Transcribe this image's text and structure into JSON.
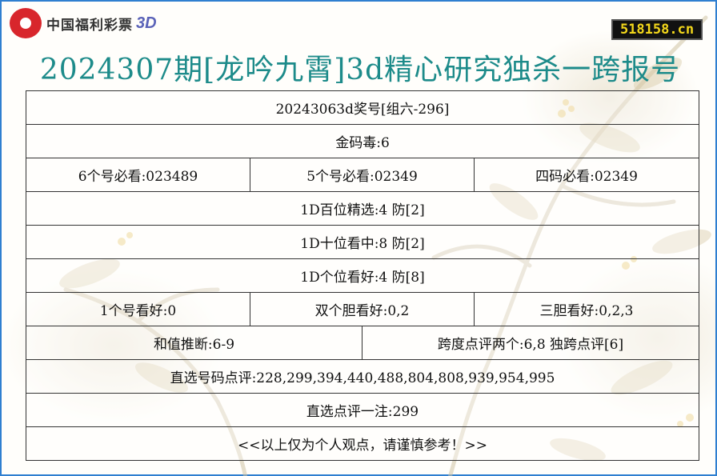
{
  "logo": {
    "text": "中国福利彩票",
    "suffix": "3D",
    "icon": "lottery-logo-icon"
  },
  "site_badge": "518158.cn",
  "title": "2024307期[龙吟九霄]3d精心研究独杀一跨报号",
  "rows": {
    "draw": "20243063d奖号[组六-296]",
    "golden": "金码毒:6",
    "six_numbers": "6个号必看:023489",
    "five_numbers": "5个号必看:02349",
    "four_numbers": "四码必看:02349",
    "hundreds": "1D百位精选:4 防[2]",
    "tens": "1D十位看中:8 防[2]",
    "units": "1D个位看好:4 防[8]",
    "one_number": "1个号看好:0",
    "double_bold": "双个胆看好:0,2",
    "triple_bold": "三胆看好:0,2,3",
    "sum_value": "和值推断:6-9",
    "span": "跨度点评两个:6,8 独跨点评[6]",
    "direct_numbers": "直选号码点评:228,299,394,440,488,804,808,939,954,995",
    "direct_one": "直选点评一注:299",
    "disclaimer": "<<以上仅为个人观点，请谨慎参考！>>"
  },
  "colors": {
    "title": "#1d8b8a",
    "border": "#2f7fd0",
    "badge_bg": "#111111",
    "badge_text": "#f4d81b",
    "logo_red": "#d8262c"
  }
}
